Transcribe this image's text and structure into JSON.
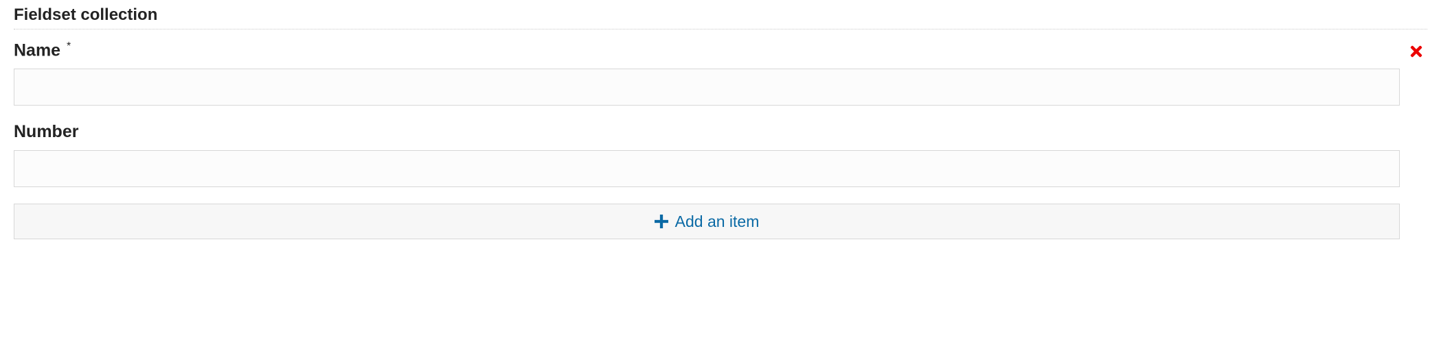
{
  "legend": "Fieldset collection",
  "fields": {
    "name": {
      "label": "Name",
      "required_marker": "*",
      "value": ""
    },
    "number": {
      "label": "Number",
      "value": ""
    }
  },
  "actions": {
    "add_item": "Add an item"
  }
}
